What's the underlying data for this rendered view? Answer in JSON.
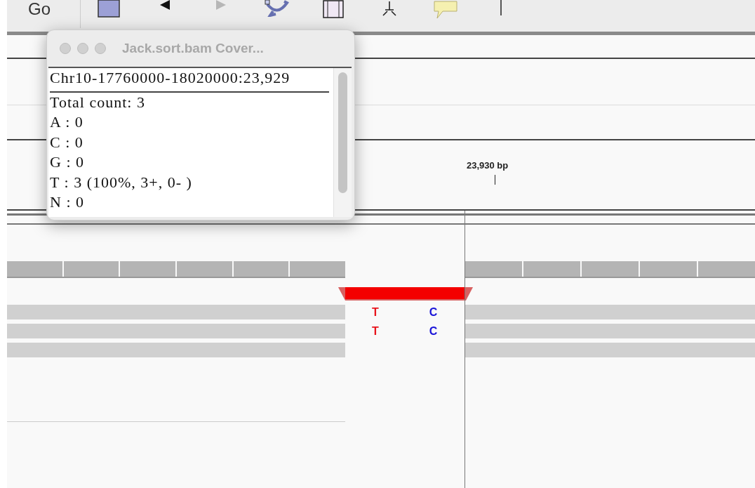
{
  "toolbar": {
    "go_label": "Go",
    "buttons": [
      {
        "kind": "square"
      },
      {
        "kind": "back",
        "disabled": false
      },
      {
        "kind": "forward",
        "disabled": true
      },
      {
        "kind": "refresh"
      },
      {
        "kind": "panel"
      },
      {
        "kind": "crosshair"
      },
      {
        "kind": "balloon"
      },
      {
        "kind": "bar"
      }
    ]
  },
  "ruler": {
    "label": "23,930 bp"
  },
  "popup": {
    "title": "Jack.sort.bam Cover...",
    "focused": false,
    "location": "Chr10-17760000-18020000:23,929",
    "lines": [
      "Total count: 3",
      "A : 0",
      "C : 0",
      "G : 0",
      "T : 3 (100%, 3+, 0- )",
      "N : 0"
    ]
  },
  "reads": [
    {
      "kind": "mismatch",
      "mismatches": [
        {
          "base": "T",
          "color": "#e8141c"
        },
        {
          "base": "C",
          "color": "#1a14d8"
        }
      ]
    },
    {
      "kind": "mismatch",
      "mismatches": [
        {
          "base": "T",
          "color": "#e8141c"
        },
        {
          "base": "C",
          "color": "#1a14d8"
        }
      ]
    },
    {
      "kind": "plain"
    }
  ]
}
